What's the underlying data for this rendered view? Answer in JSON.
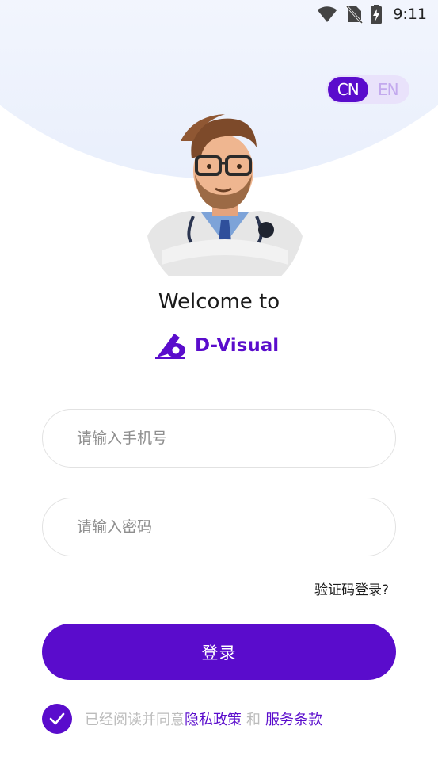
{
  "status_bar": {
    "time": "9:11",
    "icons": [
      "wifi-icon",
      "no-sim-icon",
      "battery-charging-icon"
    ]
  },
  "language_toggle": {
    "options": [
      {
        "label": "CN",
        "active": true
      },
      {
        "label": "EN",
        "active": false
      }
    ]
  },
  "avatar": {
    "icon": "doctor-avatar"
  },
  "welcome": {
    "title": "Welcome to",
    "brand_name": "D-Visual",
    "brand_logo": "d-visual-logo-icon"
  },
  "form": {
    "phone_placeholder": "请输入手机号",
    "password_placeholder": "请输入密码",
    "code_login_link": "验证码登录?",
    "login_button": "登录"
  },
  "agreement": {
    "checked": true,
    "prefix": "已经阅读并同意",
    "privacy_policy": "隐私政策",
    "conjunction": "和",
    "terms_of_service": "服务条款"
  },
  "colors": {
    "primary": "#5a0ccc",
    "toggle_bg": "#e9e2fb",
    "toggle_inactive_text": "#c3a9ee",
    "placeholder": "#8e8e8e",
    "muted_text": "#bcbcbc"
  }
}
